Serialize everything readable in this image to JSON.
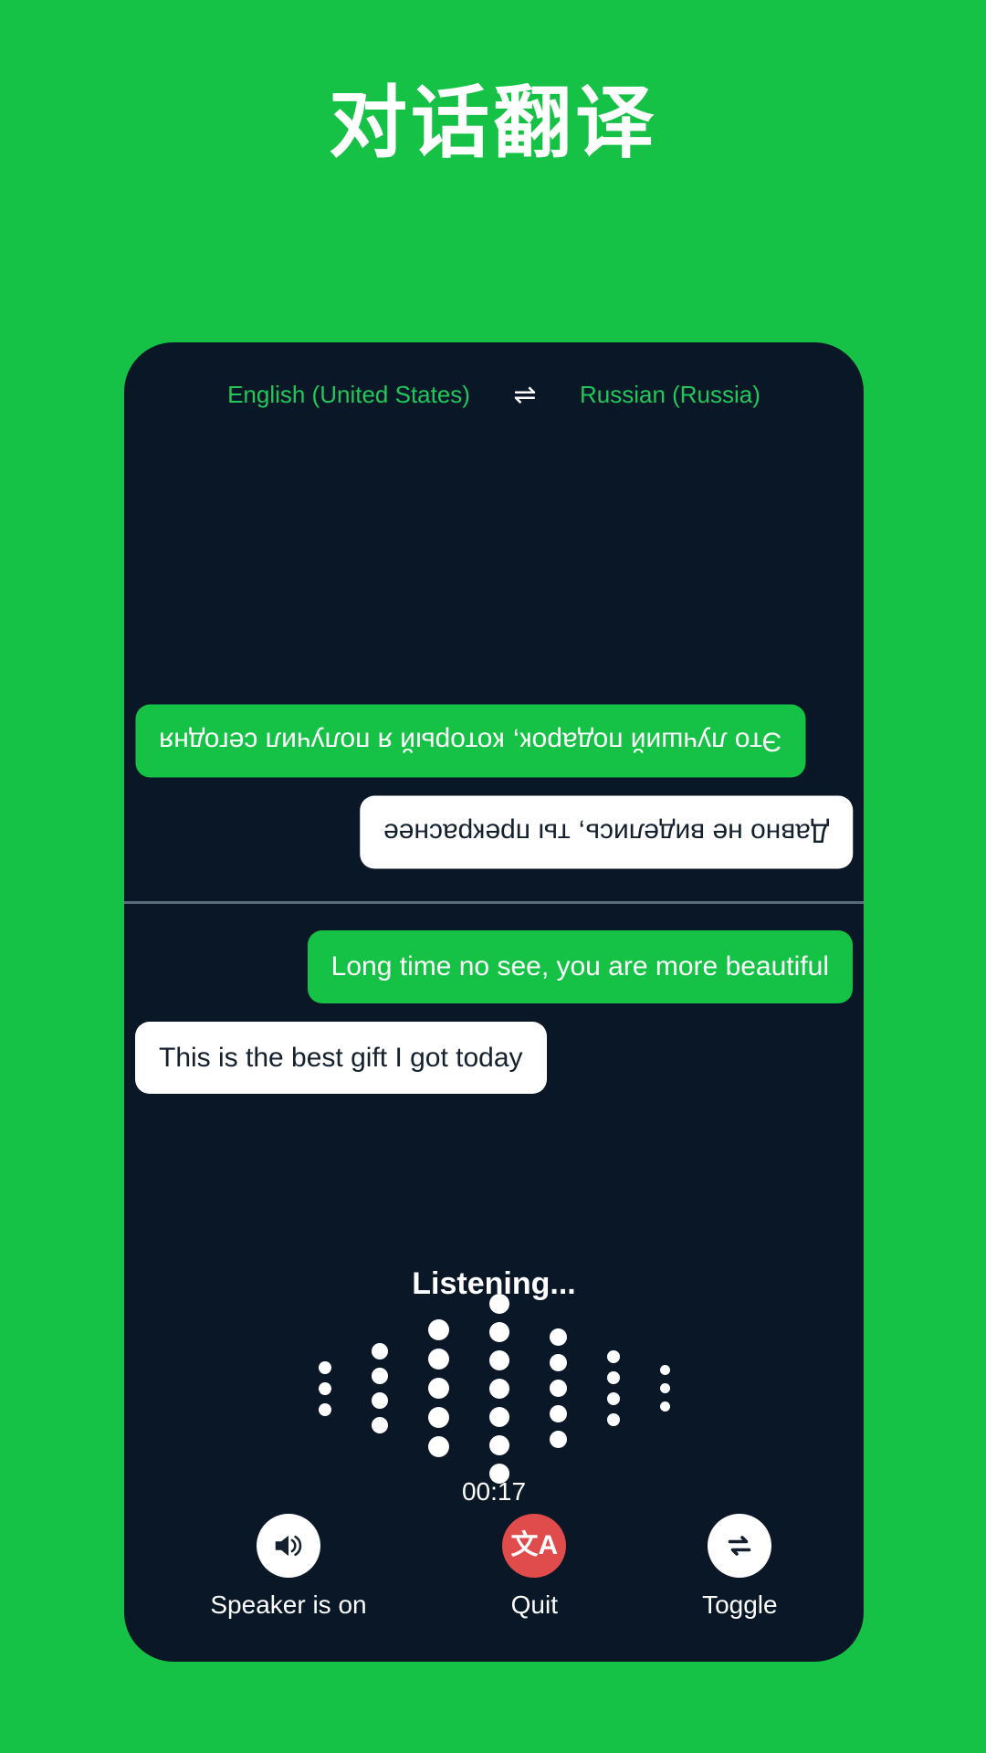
{
  "title": "对话翻译",
  "colors": {
    "background_green": "#15C245",
    "card_navy": "#0A1727",
    "accent_green": "#22C75A",
    "quit_red": "#E04B4B",
    "white": "#FFFFFF",
    "divider": "#5A6B7C"
  },
  "language_bar": {
    "source_language": "English (United States)",
    "swap_icon": "swap-horizontal-icon",
    "swap_glyph": "⇌",
    "target_language": "Russian (Russia)"
  },
  "conversation": {
    "top_panel_rotated": true,
    "top_messages": [
      {
        "text": "Это лучший подарок, который я получил сегодня",
        "style": "green",
        "align": "left"
      },
      {
        "text": "Давно не виделись, ты прекраснее",
        "style": "white",
        "align": "right"
      }
    ],
    "bottom_messages": [
      {
        "text": "Long time no see, you are more beautiful",
        "style": "green",
        "align": "right"
      },
      {
        "text": "This is the best gift I got today",
        "style": "white",
        "align": "left"
      }
    ]
  },
  "status": {
    "listening_label": "Listening...",
    "timer": "00:17"
  },
  "waveform": {
    "columns": [
      {
        "dots": 3,
        "size": 14
      },
      {
        "dots": 4,
        "size": 18
      },
      {
        "dots": 5,
        "size": 23
      },
      {
        "dots": 7,
        "size": 22
      },
      {
        "dots": 5,
        "size": 19
      },
      {
        "dots": 4,
        "size": 14
      },
      {
        "dots": 3,
        "size": 11
      }
    ]
  },
  "controls": [
    {
      "label": "Speaker is on",
      "icon": "speaker-on-icon",
      "glyph": "🔊",
      "circle": "white"
    },
    {
      "label": "Quit",
      "icon": "translate-icon",
      "glyph": "文A",
      "circle": "red"
    },
    {
      "label": "Toggle",
      "icon": "repeat-swap-icon",
      "glyph": "⇄",
      "circle": "white"
    }
  ]
}
